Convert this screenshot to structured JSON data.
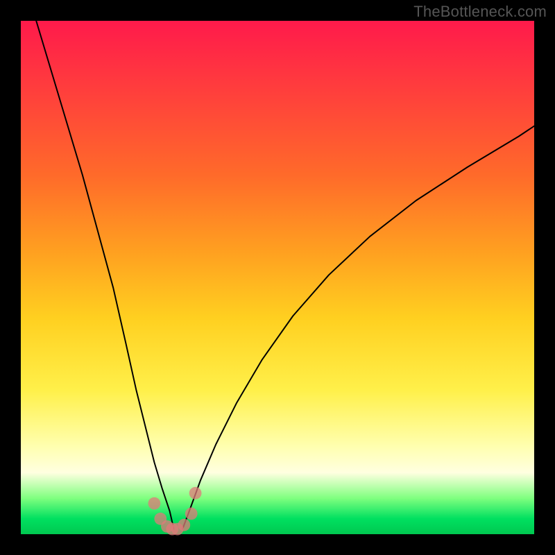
{
  "watermark": "TheBottleneck.com",
  "colors": {
    "gradient_top": "#ff1a4b",
    "gradient_bottom": "#00c850",
    "curve": "#000000",
    "markers": "#e07a7a",
    "frame": "#000000"
  },
  "chart_data": {
    "type": "line",
    "title": "",
    "xlabel": "",
    "ylabel": "",
    "x_range_norm": [
      0,
      1
    ],
    "y_range_norm": [
      0,
      1
    ],
    "description": "Abstract bottleneck curve. Two black lines descending from upper-left and upper-right toward a minimum near x≈0.30 at the bottom where they merge. A cluster of salmon dots sits at the trough. Background is a red→orange→yellow→green vertical gradient inside a thick black frame.",
    "series": [
      {
        "name": "left-branch",
        "x": [
          0.03,
          0.06,
          0.09,
          0.12,
          0.15,
          0.18,
          0.205,
          0.225,
          0.245,
          0.26,
          0.275,
          0.29,
          0.298
        ],
        "y": [
          1.0,
          0.9,
          0.8,
          0.7,
          0.59,
          0.48,
          0.37,
          0.28,
          0.2,
          0.14,
          0.09,
          0.045,
          0.01
        ]
      },
      {
        "name": "right-branch",
        "x": [
          0.315,
          0.33,
          0.35,
          0.38,
          0.42,
          0.47,
          0.53,
          0.6,
          0.68,
          0.77,
          0.87,
          0.97,
          1.0
        ],
        "y": [
          0.01,
          0.05,
          0.105,
          0.175,
          0.255,
          0.34,
          0.425,
          0.505,
          0.58,
          0.65,
          0.715,
          0.775,
          0.795
        ]
      }
    ],
    "markers": {
      "name": "trough-dots",
      "x": [
        0.26,
        0.272,
        0.285,
        0.295,
        0.305,
        0.318,
        0.332,
        0.34
      ],
      "y": [
        0.06,
        0.03,
        0.015,
        0.01,
        0.01,
        0.018,
        0.04,
        0.08
      ],
      "r_norm": 0.012
    }
  }
}
